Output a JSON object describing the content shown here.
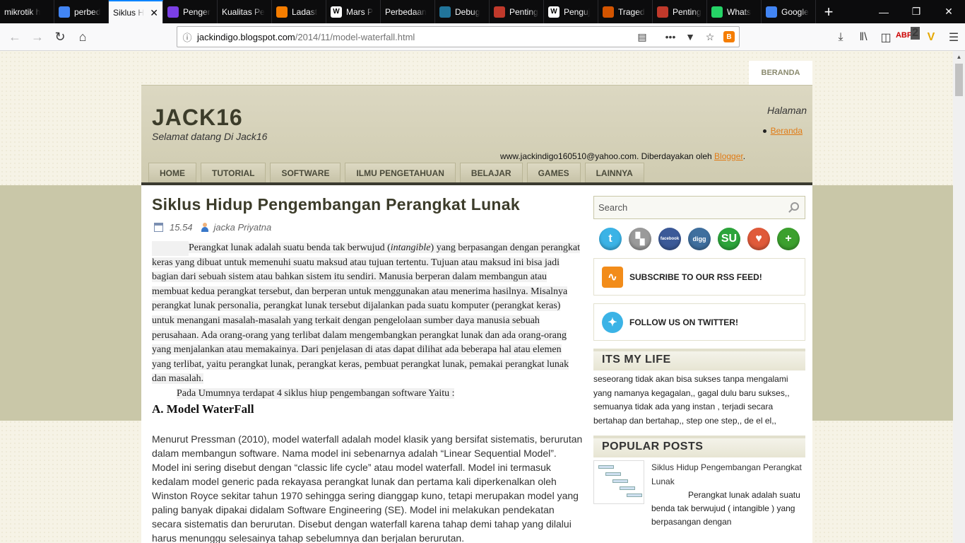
{
  "browser": {
    "tabs": [
      {
        "label": "mikrotik h",
        "icon": "none-icon",
        "color": ""
      },
      {
        "label": "perbed",
        "icon": "google-icon",
        "color": "#4285f4"
      },
      {
        "label": "Siklus H",
        "icon": "none-icon",
        "color": "",
        "active": true
      },
      {
        "label": "Penger",
        "icon": "yahoo-icon",
        "color": "#7b3fe4"
      },
      {
        "label": "Kualitas Pe",
        "icon": "none-icon",
        "color": ""
      },
      {
        "label": "Ladast",
        "icon": "blogger-icon",
        "color": "#f57d00"
      },
      {
        "label": "Mars P",
        "icon": "wikipedia-icon",
        "color": "#ffffff"
      },
      {
        "label": "Perbedaan",
        "icon": "none-icon",
        "color": ""
      },
      {
        "label": "Debug",
        "icon": "wordpress-icon",
        "color": "#21759b"
      },
      {
        "label": "Penting",
        "icon": "brainly-icon",
        "color": "#c0392b"
      },
      {
        "label": "Penguj",
        "icon": "wikipedia-icon",
        "color": "#ffffff"
      },
      {
        "label": "Traged",
        "icon": "site-icon",
        "color": "#d35400"
      },
      {
        "label": "Penting",
        "icon": "brainly-icon",
        "color": "#c0392b"
      },
      {
        "label": "Whats",
        "icon": "whatsapp-icon",
        "color": "#25d366"
      },
      {
        "label": "Google",
        "icon": "translate-icon",
        "color": "#4285f4"
      }
    ],
    "url_host": "jackindigo.blogspot.com",
    "url_path": "/2014/11/model-waterfall.html",
    "abp_count": "2"
  },
  "page": {
    "top_tab": "BERANDA",
    "blog_title": "JACK16",
    "blog_desc": "Selamat datang Di Jack16",
    "halaman_title": "Halaman",
    "halaman_link": "Beranda",
    "attribution_text": "www.jackindigo160510@yahoo.com. Diberdayakan oleh ",
    "attribution_link": "Blogger",
    "attribution_end": ".",
    "nav": [
      "HOME",
      "TUTORIAL",
      "SOFTWARE",
      "ILMU PENGETAHUAN",
      "BELAJAR",
      "GAMES",
      "LAINNYA"
    ],
    "post": {
      "title": "Siklus Hidup Pengembangan Perangkat Lunak",
      "time": "15.54",
      "author": "jacka Priyatna",
      "para1_a": "Perangkat lunak adalah suatu benda tak berwujud (",
      "para1_em": "intangible",
      "para1_b": ") yang berpasangan dengan perangkat keras yang dibuat untuk memenuhi suatu maksud atau tujuan tertentu. Tujuan atau maksud ini bisa jadi bagian dari sebuah sistem atau bahkan sistem itu sendiri. Manusia berperan dalam membangun atau membuat kedua perangkat tersebut, dan berperan untuk menggunakan atau menerima hasilnya. Misalnya perangkat lunak personalia, perangkat lunak tersebut dijalankan pada suatu komputer (perangkat keras) untuk menangani masalah-masalah yang terkait dengan pengelolaan sumber daya manusia sebuah perusahaan. Ada orang-orang yang terlibat dalam mengembangkan perangkat lunak dan ada orang-orang yang menjalankan atau memakainya. Dari penjelasan di atas dapat dilihat ada beberapa hal atau elemen yang terlibat, yaitu perangkat lunak, perangkat keras, pembuat perangkat lunak, pemakai perangkat lunak dan masalah.",
      "para2": "Pada Umumnya terdapat 4 siklus hiup pengembangan software Yaitu :",
      "subheading": "A. Model WaterFall",
      "para3": "Menurut Pressman (2010), model waterfall adalah model klasik yang bersifat sistematis, berurutan dalam membangun software. Nama model ini sebenarnya adalah “Linear Sequential Model”. Model ini sering disebut dengan “classic life cycle” atau model waterfall. Model ini termasuk kedalam model generic pada rekayasa perangkat lunak dan pertama kali diperkenalkan oleh Winston Royce sekitar tahun 1970 sehingga sering dianggap kuno, tetapi merupakan model yang paling banyak dipakai didalam Software Engineering (SE). Model ini melakukan pendekatan secara sistematis dan berurutan. Disebut dengan waterfall karena tahap demi tahap yang dilalui harus menunggu selesainya tahap sebelumnya dan berjalan berurutan."
    },
    "sidebar": {
      "search_placeholder": "Search",
      "social": [
        {
          "name": "twitter-icon",
          "color": "#3bb3e6",
          "glyph": "t"
        },
        {
          "name": "delicious-icon",
          "color": "#9a9a9a",
          "glyph": "▚"
        },
        {
          "name": "facebook-icon",
          "color": "#3b5998",
          "glyph": "facebook"
        },
        {
          "name": "digg-icon",
          "color": "#3f6f9e",
          "glyph": "digg"
        },
        {
          "name": "stumbleupon-icon",
          "color": "#2ca43b",
          "glyph": "SU"
        },
        {
          "name": "favorite-heart-icon",
          "color": "#e05a3a",
          "glyph": "♥"
        },
        {
          "name": "add-more-icon",
          "color": "#3ca02e",
          "glyph": "+"
        }
      ],
      "rss_label": "SUBSCRIBE TO OUR RSS FEED!",
      "twitter_label": "FOLLOW US ON TWITTER!",
      "life_title": "ITS MY LIFE",
      "life_text": "seseorang tidak akan bisa sukses tanpa mengalami yang namanya kegagalan,, gagal dulu baru sukses,, semuanya tidak ada yang instan , terjadi secara bertahap dan bertahap,, step one step,, de el el,,",
      "popular_title": "POPULAR POSTS",
      "popular_post_title": "Siklus Hidup Pengembangan Perangkat Lunak",
      "popular_post_excerpt": "Perangkat lunak adalah suatu benda tak berwujud ( intangible ) yang berpasangan dengan"
    }
  }
}
